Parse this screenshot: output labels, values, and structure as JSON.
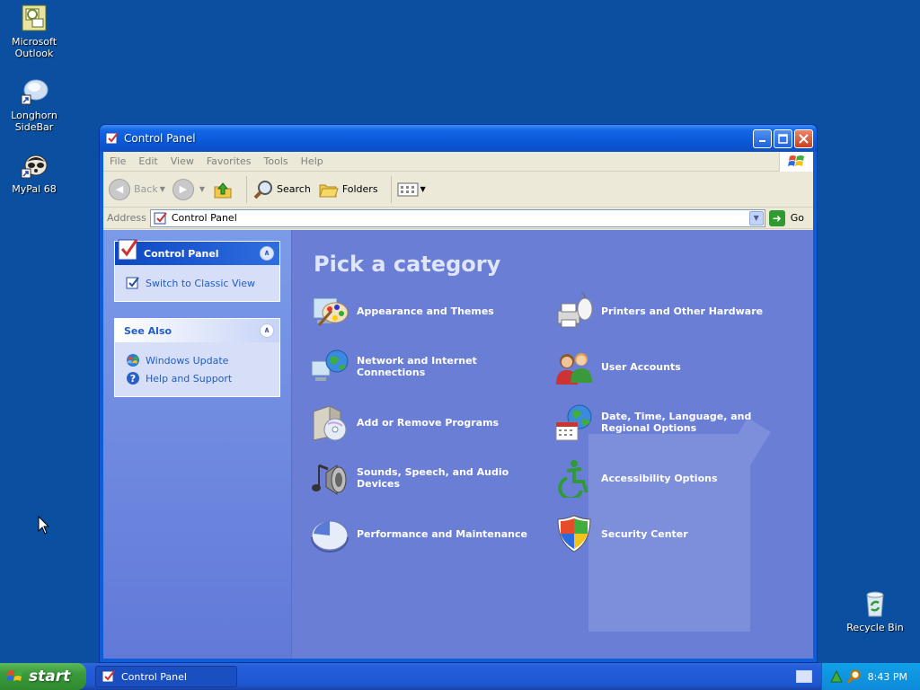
{
  "desktop": {
    "icons": [
      {
        "label": "Microsoft Outlook"
      },
      {
        "label": "Longhorn SideBar"
      },
      {
        "label": "MyPal 68"
      },
      {
        "label": "Recycle Bin"
      }
    ]
  },
  "window": {
    "title": "Control Panel",
    "menu": [
      "File",
      "Edit",
      "View",
      "Favorites",
      "Tools",
      "Help"
    ],
    "toolbar": {
      "back": "Back",
      "search": "Search",
      "folders": "Folders"
    },
    "address": {
      "label": "Address",
      "value": "Control Panel",
      "go": "Go"
    }
  },
  "taskpane": {
    "control_panel": {
      "title": "Control Panel",
      "link": "Switch to Classic View"
    },
    "see_also": {
      "title": "See Also",
      "links": [
        "Windows Update",
        "Help and Support"
      ]
    }
  },
  "main": {
    "heading": "Pick a category",
    "categories": [
      {
        "label": "Appearance and Themes",
        "icon": "appearance-themes-icon"
      },
      {
        "label": "Printers and Other Hardware",
        "icon": "printers-hardware-icon"
      },
      {
        "label": "Network and Internet Connections",
        "icon": "network-connections-icon"
      },
      {
        "label": "User Accounts",
        "icon": "user-accounts-icon"
      },
      {
        "label": "Add or Remove Programs",
        "icon": "add-remove-programs-icon"
      },
      {
        "label": "Date, Time, Language, and Regional Options",
        "icon": "date-time-language-icon"
      },
      {
        "label": "Sounds, Speech, and Audio Devices",
        "icon": "sounds-audio-icon"
      },
      {
        "label": "Accessibility Options",
        "icon": "accessibility-icon"
      },
      {
        "label": "Performance and Maintenance",
        "icon": "performance-maintenance-icon"
      },
      {
        "label": "Security Center",
        "icon": "security-center-icon"
      }
    ]
  },
  "taskbar": {
    "start_label": "start",
    "tasks": [
      {
        "label": "Control Panel"
      }
    ],
    "clock": "8:43 PM"
  },
  "colors": {
    "desktop": "#0b4fa0",
    "main_panel": "#6b7ed6",
    "link": "#215dc6",
    "start_green": "#3a9a3a"
  }
}
